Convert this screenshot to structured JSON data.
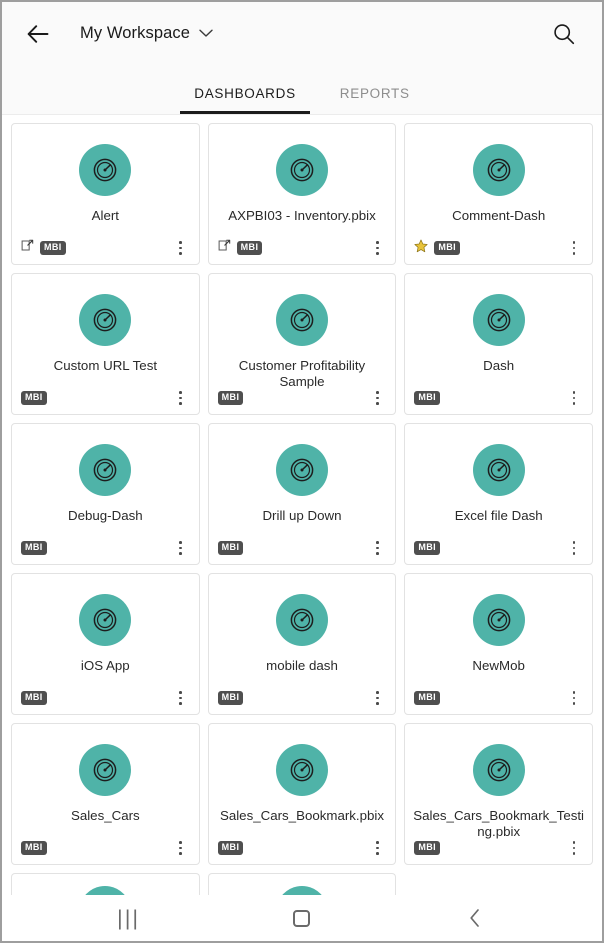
{
  "header": {
    "back_icon": "arrow-left-icon",
    "title": "My Workspace",
    "dropdown_icon": "chevron-down-icon",
    "search_icon": "search-icon"
  },
  "tabs": [
    {
      "label": "DASHBOARDS",
      "active": true
    },
    {
      "label": "REPORTS",
      "active": false
    }
  ],
  "badges": {
    "mbi_label": "MBI",
    "star_icon": "star-icon",
    "share_icon": "share-icon",
    "kebab_icon": "more-vertical-icon",
    "tile_icon": "gauge-dashboard-icon"
  },
  "colors": {
    "tile_accent": "#4FB3A8",
    "badge_bg": "#4F4F4F",
    "star": "#E8C33A",
    "tab_active": "#1C1C1C",
    "tab_inactive": "#8D8D8D"
  },
  "cards": [
    {
      "title": "Alert",
      "mbi": "MBI",
      "star": false,
      "shared": true,
      "partial": false,
      "hidden": false
    },
    {
      "title": "AXPBI03 - Inventory.pbix",
      "mbi": "MBI",
      "star": false,
      "shared": true,
      "partial": false,
      "hidden": false
    },
    {
      "title": "Comment-Dash",
      "mbi": "MBI",
      "star": true,
      "shared": false,
      "partial": false,
      "hidden": false
    },
    {
      "title": "Custom URL Test",
      "mbi": "MBI",
      "star": false,
      "shared": false,
      "partial": false,
      "hidden": false
    },
    {
      "title": "Customer Profitability Sample",
      "mbi": "MBI",
      "star": false,
      "shared": false,
      "partial": false,
      "hidden": false
    },
    {
      "title": "Dash",
      "mbi": "MBI",
      "star": false,
      "shared": false,
      "partial": false,
      "hidden": false
    },
    {
      "title": "Debug-Dash",
      "mbi": "MBI",
      "star": false,
      "shared": false,
      "partial": false,
      "hidden": false
    },
    {
      "title": "Drill up Down",
      "mbi": "MBI",
      "star": false,
      "shared": false,
      "partial": false,
      "hidden": false
    },
    {
      "title": "Excel file Dash",
      "mbi": "MBI",
      "star": false,
      "shared": false,
      "partial": false,
      "hidden": false
    },
    {
      "title": "iOS App",
      "mbi": "MBI",
      "star": false,
      "shared": false,
      "partial": false,
      "hidden": false
    },
    {
      "title": "mobile dash",
      "mbi": "MBI",
      "star": false,
      "shared": false,
      "partial": false,
      "hidden": false
    },
    {
      "title": "NewMob",
      "mbi": "MBI",
      "star": false,
      "shared": false,
      "partial": false,
      "hidden": false
    },
    {
      "title": "Sales_Cars",
      "mbi": "MBI",
      "star": false,
      "shared": false,
      "partial": false,
      "hidden": false
    },
    {
      "title": "Sales_Cars_Bookmark.pbix",
      "mbi": "MBI",
      "star": false,
      "shared": false,
      "partial": false,
      "hidden": false
    },
    {
      "title": "Sales_Cars_Bookmark_Testing.pbix",
      "mbi": "MBI",
      "star": false,
      "shared": false,
      "partial": false,
      "hidden": false
    },
    {
      "title": "",
      "mbi": "",
      "star": false,
      "shared": false,
      "partial": true,
      "hidden": false
    },
    {
      "title": "",
      "mbi": "",
      "star": false,
      "shared": false,
      "partial": true,
      "hidden": false
    },
    {
      "title": "",
      "mbi": "",
      "star": false,
      "shared": false,
      "partial": true,
      "hidden": true
    }
  ],
  "nav_bar": {
    "recents_label": "|||",
    "recents_icon": "recents-icon",
    "home_icon": "home-icon",
    "back_icon": "back-chevron-icon"
  }
}
